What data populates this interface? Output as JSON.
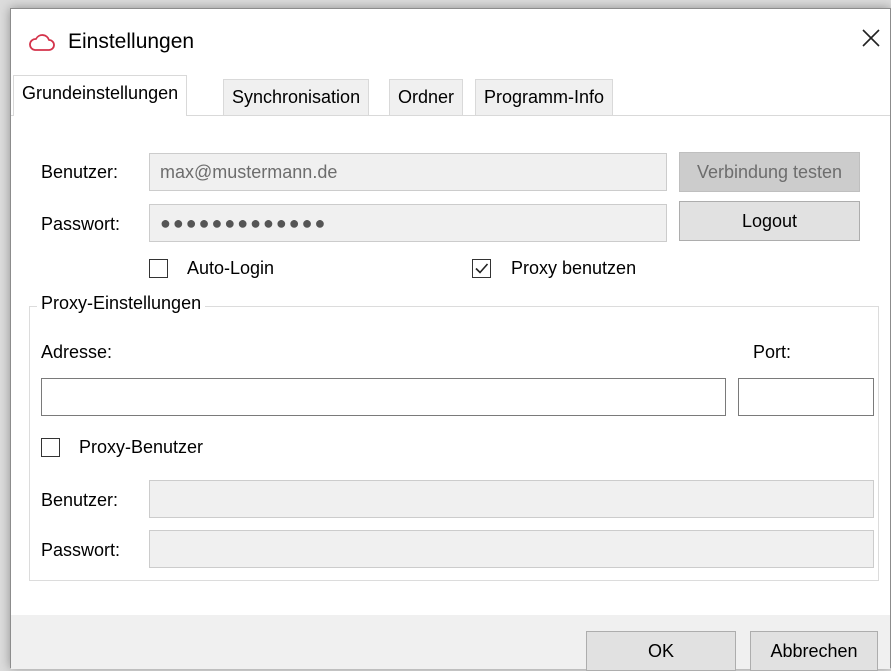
{
  "window": {
    "title": "Einstellungen",
    "icon": "cloud-icon",
    "close_icon": "close-icon"
  },
  "tabs": [
    {
      "label": "Grundeinstellungen",
      "active": true
    },
    {
      "label": "Synchronisation",
      "active": false
    },
    {
      "label": "Ordner",
      "active": false
    },
    {
      "label": "Programm-Info",
      "active": false
    }
  ],
  "account": {
    "user_label": "Benutzer:",
    "user_value": "max@mustermann.de",
    "password_label": "Passwort:",
    "password_value": "●●●●●●●●●●●●●",
    "test_button": "Verbindung testen",
    "logout_button": "Logout",
    "auto_login_label": "Auto-Login",
    "auto_login_checked": false,
    "proxy_use_label": "Proxy benutzen",
    "proxy_use_checked": true
  },
  "proxy": {
    "group_title": "Proxy-Einstellungen",
    "address_label": "Adresse:",
    "address_value": "",
    "port_label": "Port:",
    "port_value": "",
    "proxy_user_label": "Proxy-Benutzer",
    "proxy_user_checked": false,
    "user_label": "Benutzer:",
    "user_value": "",
    "password_label": "Passwort:",
    "password_value": ""
  },
  "footer": {
    "ok_button": "OK",
    "cancel_button": "Abbrechen"
  },
  "colors": {
    "accent_icon": "#d4334b",
    "panel_bg": "#ffffff",
    "window_bg": "#f0f0f0"
  }
}
